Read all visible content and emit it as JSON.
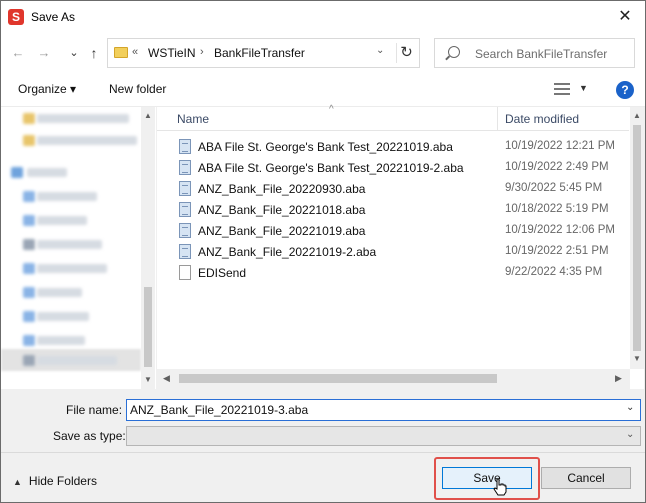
{
  "window": {
    "title": "Save As",
    "app_icon_letter": "S",
    "close_glyph": "✕"
  },
  "navigation": {
    "back_glyph": "←",
    "forward_glyph": "→",
    "recent_glyph": "⌄",
    "up_glyph": "↑",
    "address": {
      "overflow": "«",
      "segments": [
        "WSTieIN",
        "BankFileTransfer"
      ],
      "separator": "›",
      "dropdown_glyph": "⌄",
      "refresh_glyph": "↻"
    },
    "search_placeholder": "Search BankFileTransfer"
  },
  "toolbar": {
    "organize_label": "Organize ▾",
    "new_folder_label": "New folder",
    "view_dropdown_glyph": "▼",
    "help_glyph": "?"
  },
  "file_list": {
    "columns": {
      "name": "Name",
      "date_modified": "Date modified",
      "sort_caret": "^"
    },
    "files": [
      {
        "name": "ABA File St. George's Bank Test_20221019.aba",
        "date": "10/19/2022 12:21 PM",
        "icon": "aba-file-icon"
      },
      {
        "name": "ABA File St. George's Bank Test_20221019-2.aba",
        "date": "10/19/2022 2:49 PM",
        "icon": "aba-file-icon"
      },
      {
        "name": "ANZ_Bank_File_20220930.aba",
        "date": "9/30/2022 5:45 PM",
        "icon": "aba-file-icon"
      },
      {
        "name": "ANZ_Bank_File_20221018.aba",
        "date": "10/18/2022 5:19 PM",
        "icon": "aba-file-icon"
      },
      {
        "name": "ANZ_Bank_File_20221019.aba",
        "date": "10/19/2022 12:06 PM",
        "icon": "aba-file-icon"
      },
      {
        "name": "ANZ_Bank_File_20221019-2.aba",
        "date": "10/19/2022 2:51 PM",
        "icon": "aba-file-icon"
      },
      {
        "name": "EDISend",
        "date": "9/22/2022 4:35 PM",
        "icon": "plain-file-icon"
      }
    ],
    "scroll_up_glyph": "▲",
    "scroll_down_glyph": "▼",
    "scroll_left_glyph": "◀",
    "scroll_right_glyph": "▶"
  },
  "form": {
    "file_name_label": "File name:",
    "file_name_value": "ANZ_Bank_File_20221019-3.aba",
    "save_as_type_label": "Save as type:",
    "save_as_type_value": "",
    "dropdown_glyph": "⌄"
  },
  "footer": {
    "hide_folders_caret": "▲",
    "hide_folders_label": "Hide Folders",
    "save_label": "Save",
    "cancel_label": "Cancel"
  },
  "colors": {
    "accent_blue": "#0078d7",
    "highlight_red": "#e0504a",
    "app_icon_red": "#e0362c",
    "help_blue": "#1a62c9"
  }
}
